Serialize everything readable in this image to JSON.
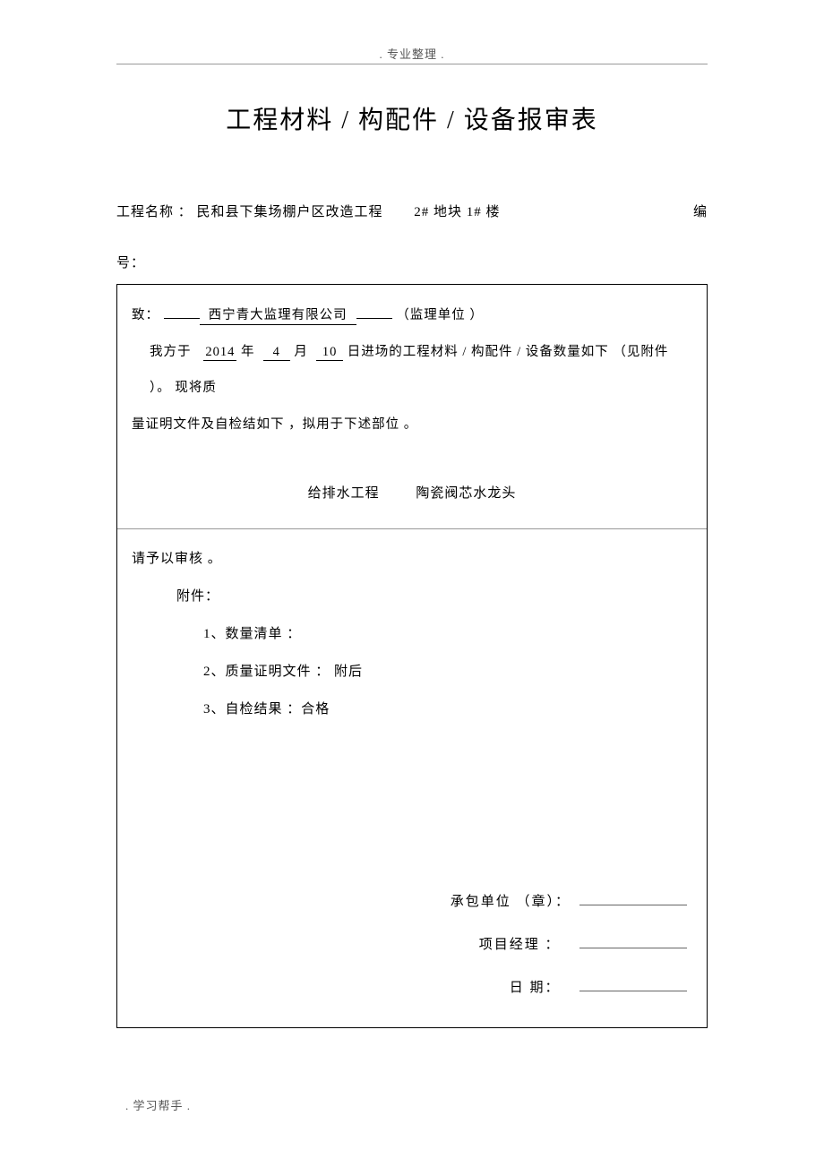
{
  "header_tag": ". 专业整理 .",
  "title": "工程材料 / 构配件 / 设备报审表",
  "meta": {
    "project_label": "工程名称 ：",
    "project_value": "民和县下集场棚户区改造工程",
    "plot_value": "2# 地块  1# 楼",
    "serial_label_1": "编",
    "serial_label_2": "号："
  },
  "section1": {
    "to_label": "致：",
    "org_value": "西宁青大监理有限公司",
    "org_suffix": "（监理单位 ）",
    "line2_a": "我方于",
    "year": "2014",
    "year_unit": "年",
    "month": "4",
    "month_unit": "月",
    "day": "10",
    "day_unit": "日进场的工程材料   / 构配件 / 设备数量如下  （见附件 ）。 现将质",
    "line3": "量证明文件及自检结如下   ，拟用于下述部位  。",
    "center_a": "给排水工程",
    "center_b": "陶瓷阀芯水龙头"
  },
  "section2": {
    "review": "请予以审核 。",
    "attach_label": "附件：",
    "a1": "1、数量清单 ：",
    "a2": "2、质量证明文件 ： 附后",
    "a3": "3、自检结果 ：合格",
    "sig1": "承包单位 （章）：",
    "sig2": "项目经理 ：",
    "sig3": "日      期："
  },
  "footer_tag": ". 学习帮手 ."
}
